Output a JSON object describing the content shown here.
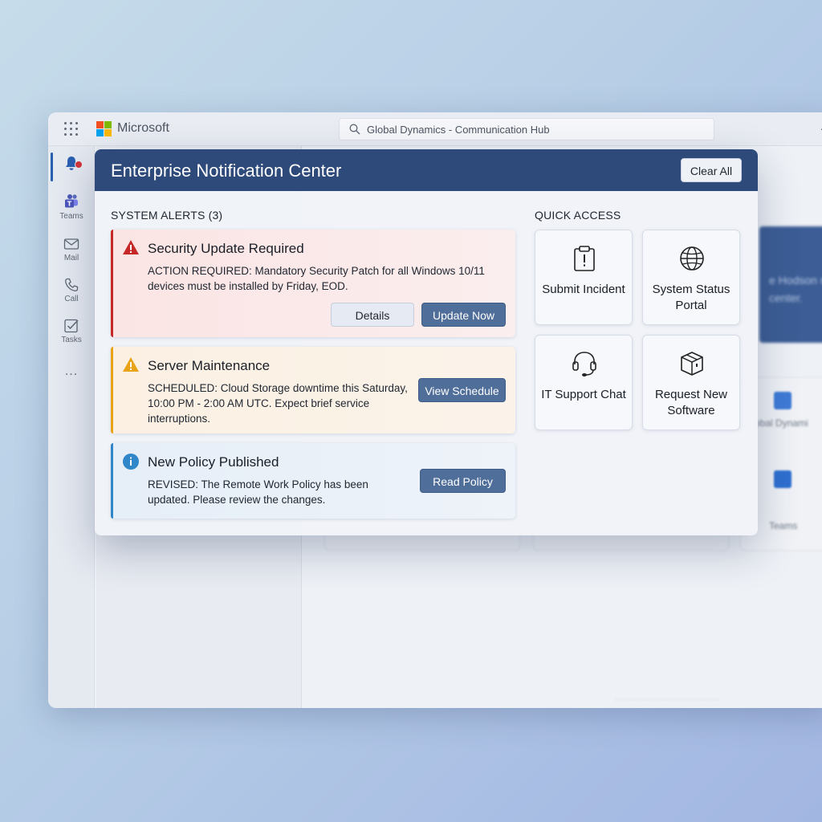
{
  "window": {
    "brand": "Microsoft",
    "search_placeholder": "Global Dynamics - Communication Hub",
    "rail": [
      {
        "label": "Teams"
      },
      {
        "label": "Mail"
      },
      {
        "label": "Call"
      },
      {
        "label": "Tasks"
      }
    ],
    "rail_more": "...",
    "background": {
      "banner_text": "e Hodson r center.",
      "card_label_1": "obal Dynami",
      "card_label_2": "Teams"
    }
  },
  "panel": {
    "title": "Enterprise Notification Center",
    "clear_all_label": "Clear All",
    "alerts_heading": "SYSTEM ALERTS (3)",
    "quick_access_heading": "QUICK ACCESS",
    "alerts": [
      {
        "severity": "error",
        "icon": "warning-triangle-icon",
        "title": "Security Update Required",
        "body": "ACTION REQUIRED: Mandatory Security Patch for all Windows 10/11 devices must be installed by Friday, EOD.",
        "actions": [
          "Details",
          "Update Now"
        ]
      },
      {
        "severity": "warning",
        "icon": "warning-triangle-icon",
        "title": "Server Maintenance",
        "body": "SCHEDULED: Cloud Storage downtime this Saturday, 10:00 PM - 2:00 AM UTC. Expect brief service interruptions.",
        "actions": [
          "View Schedule"
        ]
      },
      {
        "severity": "info",
        "icon": "info-icon",
        "title": "New Policy Published",
        "body": "REVISED: The Remote Work Policy has been updated. Please review the changes.",
        "actions": [
          "Read Policy"
        ]
      }
    ],
    "quick_access": [
      {
        "label": "Submit Incident",
        "icon": "clipboard-alert-icon"
      },
      {
        "label": "System Status Portal",
        "icon": "globe-icon"
      },
      {
        "label": "IT Support Chat",
        "icon": "headset-icon"
      },
      {
        "label": "Request New Software",
        "icon": "package-icon"
      }
    ]
  },
  "colors": {
    "header": "#2d4a7a",
    "error": "#c62828",
    "warning": "#e8a317",
    "info": "#2f86c8",
    "primary_button": "#4f6e9a"
  }
}
